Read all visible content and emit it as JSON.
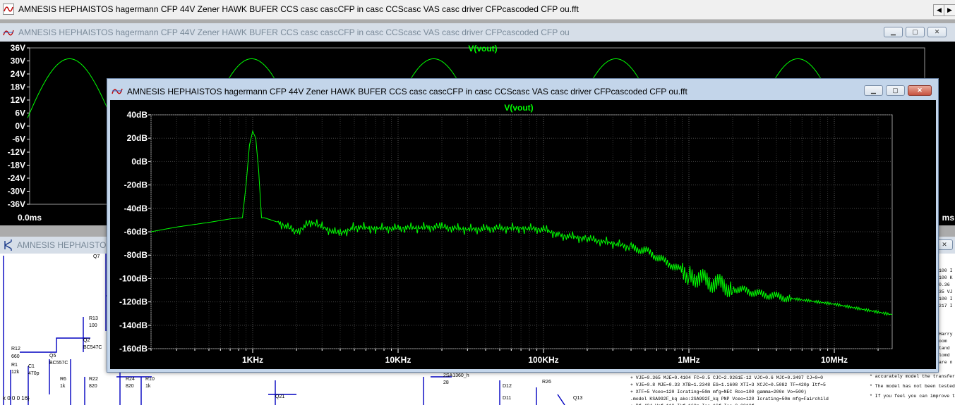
{
  "mdi": {
    "title": "AMNESIS HEPHAISTOS hagermann  CFP 44V Zener HAWK BUFER CCS casc cascCFP in casc CCScasc VAS casc driver CFPcascoded CFP ou.fft",
    "scroll_left": "◀",
    "scroll_right": "▶"
  },
  "time_window": {
    "title": "AMNESIS HEPHAISTOS hagermann  CFP 44V Zener HAWK BUFER CCS casc cascCFP in casc CCScasc VAS casc driver CFPcascoded CFP ou",
    "trace_label": "V(vout)",
    "y_ticks": [
      "36V",
      "30V",
      "24V",
      "18V",
      "12V",
      "6V",
      "0V",
      "-6V",
      "-12V",
      "-18V",
      "-24V",
      "-30V",
      "-36V"
    ],
    "x_start": "0.0ms",
    "x_end_partial": "ms",
    "trace_color": "#00ff00"
  },
  "schematic_window": {
    "title": "AMNESIS HEPHAISTOS",
    "labels": [
      "Q7",
      "R13",
      "100",
      "Q2",
      "BC547C",
      "R12",
      "660",
      "R1",
      "12k",
      "C1",
      "470p",
      "Q5",
      "BC557C",
      "R6",
      "1k",
      "R22",
      "820",
      "R24",
      "820",
      "R10",
      "1k",
      "Q21",
      "D12",
      "D11",
      "R26",
      "Q13",
      "2SA1360_h",
      "28"
    ],
    "bottom_text": "k 0 0 0 16}",
    "right_notes": [
      "+ VJE=0.365 MJE=0.4104 FC=0.5 CJC=2.9261E-12 VJC=0.6 MJC=0.3497 CJ=0=0",
      "+ VJE=0.8 MJE=0.33 XTB=1.2348 EG=1.1608 XTI=3 XCJC=0.5082 TF=420p Itf=5",
      "+ XTF=5 Vceo=120 Icrating=50m mfg=NEC Rco=100 gamma=200n Vo=500)",
      ".model KSA992F_kq ako:2SA992F_kq PNP Vceo=120 Icrating=50m mfg=Fairchild",
      "+ Bf=404 Vaf=110 Ikf=160m Ise=16f Isc=0.0010f"
    ],
    "far_right_notes": [
      "* accurately model the transfer a",
      "* The model has not been tested of a",
      "* If you feel you can improve the m"
    ],
    "edge_fragments": [
      "100 I",
      "100 K",
      "0.36",
      "35 VJ",
      "100 I",
      "217 I",
      "Harry",
      "oom",
      "tand",
      "lomd",
      "are n"
    ]
  },
  "fft_window": {
    "title": "AMNESIS HEPHAISTOS hagermann  CFP 44V Zener HAWK BUFER CCS casc cascCFP in casc CCScasc VAS casc driver CFPcascoded CFP ou.fft",
    "trace_label": "V(vout)"
  },
  "colors": {
    "plot_bg": "#000000",
    "trace": "#00ff00",
    "grid": "#4a4a4a",
    "axis_text": "#ffffff",
    "schematic_wire": "#0000c0"
  },
  "chart_data": [
    {
      "type": "line",
      "title": "V(vout)",
      "xlabel": "",
      "ylabel": "",
      "x_scale": "linear",
      "xlim_labels": [
        "0.0ms"
      ],
      "ylim": [
        -36,
        36
      ],
      "y_ticks": [
        36,
        30,
        24,
        18,
        12,
        6,
        0,
        -6,
        -12,
        -18,
        -24,
        -30,
        -36
      ],
      "grid": false,
      "series": [
        {
          "name": "V(vout)",
          "shape": "half-wave rectified sine",
          "peak": 31,
          "trough": 0,
          "visible_peaks": 5
        }
      ]
    },
    {
      "type": "line",
      "title": "V(vout)",
      "xlabel": "",
      "ylabel": "",
      "x_scale": "log",
      "x_ticks": [
        "1KHz",
        "10KHz",
        "100KHz",
        "1MHz",
        "10MHz"
      ],
      "x_tick_values": [
        1000,
        10000,
        100000,
        1000000,
        10000000
      ],
      "xlim": [
        200,
        25000000
      ],
      "ylim": [
        -160,
        40
      ],
      "y_ticks": [
        "40dB",
        "20dB",
        "0dB",
        "-20dB",
        "-40dB",
        "-60dB",
        "-80dB",
        "-100dB",
        "-120dB",
        "-140dB",
        "-160dB"
      ],
      "grid": true,
      "series": [
        {
          "name": "V(vout)",
          "x": [
            200,
            300,
            500,
            700,
            850,
            900,
            950,
            1000,
            1050,
            1100,
            1150,
            1200,
            1500,
            2000,
            2500,
            3000,
            4000,
            5000,
            7000,
            10000,
            20000,
            30000,
            50000,
            70000,
            100000,
            130000,
            200000,
            300000,
            500000,
            700000,
            1000000,
            1500000,
            2000000,
            3000000,
            5000000,
            10000000,
            15000000,
            25000000
          ],
          "y": [
            -60,
            -56,
            -52,
            -49,
            -48,
            -20,
            14,
            26,
            20,
            -8,
            -48,
            -48,
            -52,
            -60,
            -52,
            -56,
            -62,
            -56,
            -57,
            -57,
            -56,
            -58,
            -57,
            -57,
            -58,
            -63,
            -66,
            -70,
            -76,
            -86,
            -97,
            -104,
            -108,
            -113,
            -117,
            -122,
            -126,
            -131
          ]
        }
      ]
    }
  ]
}
